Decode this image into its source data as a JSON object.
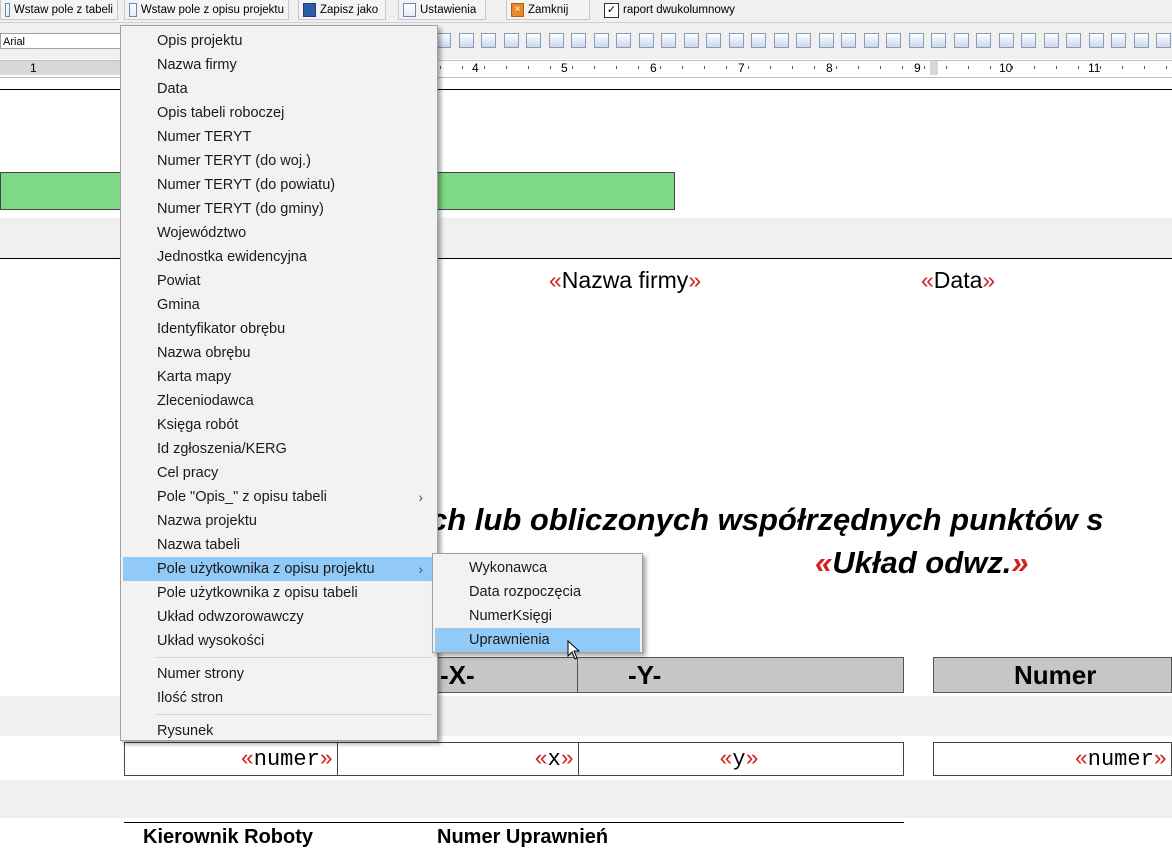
{
  "toolbar": {
    "insert_field_table": "Wstaw pole z tabeli",
    "insert_field_project": "Wstaw pole z opisu projektu",
    "save_as": "Zapisz jako",
    "settings": "Ustawienia",
    "close": "Zamknij",
    "two_column_label": "raport dwukolumnowy",
    "two_column_checked": true
  },
  "format_bar": {
    "font": "Arial"
  },
  "ruler": {
    "numbers": [
      "1",
      "4",
      "5",
      "6",
      "7",
      "8",
      "9",
      "10",
      "11"
    ]
  },
  "document": {
    "company_field": {
      "open": "«",
      "name": "Nazwa firmy",
      "close": "»"
    },
    "date_field": {
      "open": "«",
      "name": "Data",
      "close": "»"
    },
    "title_line": "ch lub obliczonych współrzędnych punktów s",
    "projection_field": {
      "open": "«",
      "name": "Układ odwz.",
      "close": "»"
    },
    "table_headers": [
      "-X-",
      "-Y-",
      "Numer"
    ],
    "row_fields": [
      {
        "open": "«",
        "name": "numer",
        "close": "»"
      },
      {
        "open": "«",
        "name": "x",
        "close": "»"
      },
      {
        "open": "«",
        "name": "y",
        "close": "»"
      },
      {
        "open": "«",
        "name": "numer",
        "close": "»"
      }
    ],
    "bottom_labels": [
      "Kierownik Roboty",
      "Numer Uprawnień"
    ]
  },
  "context_menu": {
    "items": [
      "Opis projektu",
      "Nazwa firmy",
      "Data",
      "Opis tabeli roboczej",
      "Numer TERYT",
      "Numer TERYT (do woj.)",
      "Numer TERYT (do powiatu)",
      "Numer TERYT (do gminy)",
      "Województwo",
      "Jednostka ewidencyjna",
      "Powiat",
      "Gmina",
      "Identyfikator obrębu",
      "Nazwa obrębu",
      "Karta mapy",
      "Zleceniodawca",
      "Księga robót",
      "Id zgłoszenia/KERG",
      "Cel pracy",
      "Pole \"Opis_\" z opisu tabeli",
      "Nazwa projektu",
      "Nazwa tabeli",
      "Pole użytkownika z opisu projektu",
      "Pole użytkownika z opisu tabeli",
      "Układ odwzorowawczy",
      "Układ wysokości"
    ],
    "group2": [
      "Numer strony",
      "Ilość stron"
    ],
    "group3": [
      "Rysunek"
    ],
    "submenu_arrow": "›"
  },
  "submenu": {
    "items": [
      "Wykonawca",
      "Data rozpoczęcia",
      "NumerKsięgi",
      "Uprawnienia"
    ]
  },
  "colors": {
    "highlight": "#91c9f7",
    "field_quote": "#d42020",
    "green_bar": "#7ed987",
    "header_gray": "#c6c6c6"
  }
}
